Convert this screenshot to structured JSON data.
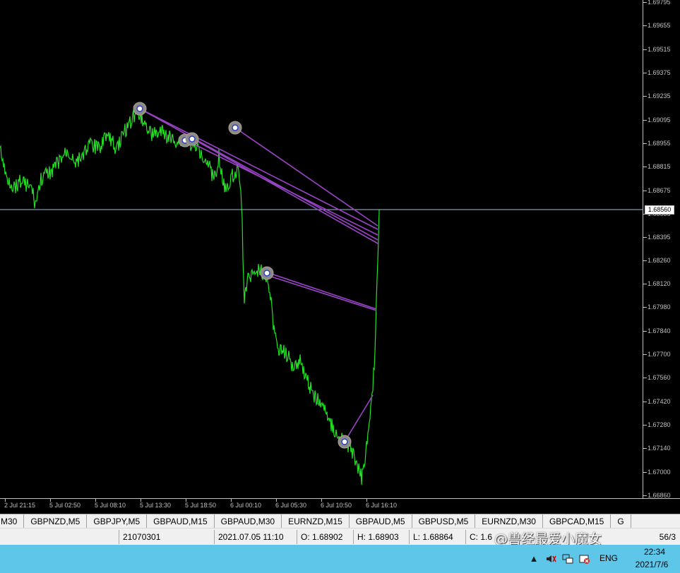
{
  "chart": {
    "price_levels": [
      "1.69795",
      "1.69655",
      "1.69515",
      "1.69375",
      "1.69235",
      "1.69095",
      "1.68955",
      "1.68815",
      "1.68675",
      "1.68535",
      "1.68395",
      "1.68260",
      "1.68120",
      "1.67980",
      "1.67840",
      "1.67700",
      "1.67560",
      "1.67420",
      "1.67280",
      "1.67140",
      "1.67000",
      "1.66860"
    ],
    "current_price": "1.68560",
    "time_labels": [
      "2 Jul 21:15",
      "5 Jul 02:50",
      "5 Jul 08:10",
      "5 Jul 13:30",
      "5 Jul 18:50",
      "6 Jul 00:10",
      "6 Jul 05:30",
      "6 Jul 10:50",
      "6 Jul 16:10"
    ],
    "line_color": "#22e022",
    "trade_line_color": "#9a44c8",
    "hline_color": "#9ac2d8"
  },
  "tabs": [
    "M30",
    "GBPNZD,M5",
    "GBPJPY,M5",
    "GBPAUD,M15",
    "GBPAUD,M30",
    "EURNZD,M15",
    "GBPAUD,M5",
    "GBPUSD,M5",
    "EURNZD,M30",
    "GBPCAD,M15",
    "G"
  ],
  "status": {
    "code": "21070301",
    "datetime": "2021.07.05 11:10",
    "open": "O: 1.68902",
    "high": "H: 1.68903",
    "low": "L: 1.68864",
    "close": "C: 1.6",
    "tail": "56/3"
  },
  "watermark": "@兽经最爱小魔女",
  "taskbar": {
    "lang": "ENG",
    "time": "22:34",
    "date": "2021/7/6",
    "icons": [
      "chevron-up-icon",
      "speaker-icon",
      "network-icon",
      "close-red-icon"
    ]
  }
}
